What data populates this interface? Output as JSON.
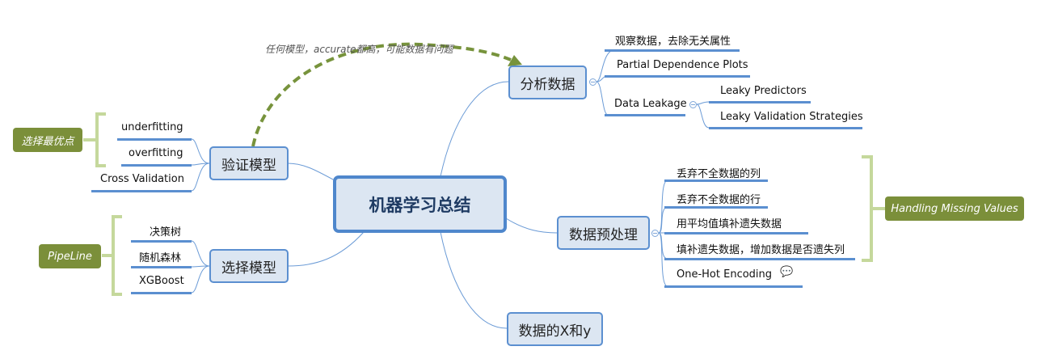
{
  "central": "机器学习总结",
  "annotation": "任何模型，accurate都高，可能数据有问题",
  "branches": {
    "analyze": {
      "label": "分析数据",
      "children": [
        "观察数据，去除无关属性",
        "Partial Dependence Plots",
        "Data Leakage"
      ],
      "leakage_children": [
        "Leaky Predictors",
        "Leaky Validation Strategies"
      ]
    },
    "validate": {
      "label": "验证模型",
      "children": [
        "underfitting",
        "overfitting",
        "Cross Validation"
      ],
      "summary": "选择最优点"
    },
    "select": {
      "label": "选择模型",
      "children": [
        "决策树",
        "随机森林",
        "XGBoost"
      ],
      "summary": "PipeLine"
    },
    "preprocess": {
      "label": "数据预处理",
      "children": [
        "丢弃不全数据的列",
        "丢弃不全数据的行",
        "用平均值填补遗失数据",
        "填补遗失数据，增加数据是否遗失列",
        "One-Hot Encoding"
      ],
      "summary": "Handling Missing Values",
      "comment_icon": "speech-bubble-icon"
    },
    "xy": {
      "label": "数据的X和y"
    }
  },
  "colors": {
    "line": "#5b8fd0",
    "node_fill": "#dce6f2",
    "summary": "#7b8f3a",
    "bracket": "#c5d89c",
    "arrow": "#77933c"
  }
}
